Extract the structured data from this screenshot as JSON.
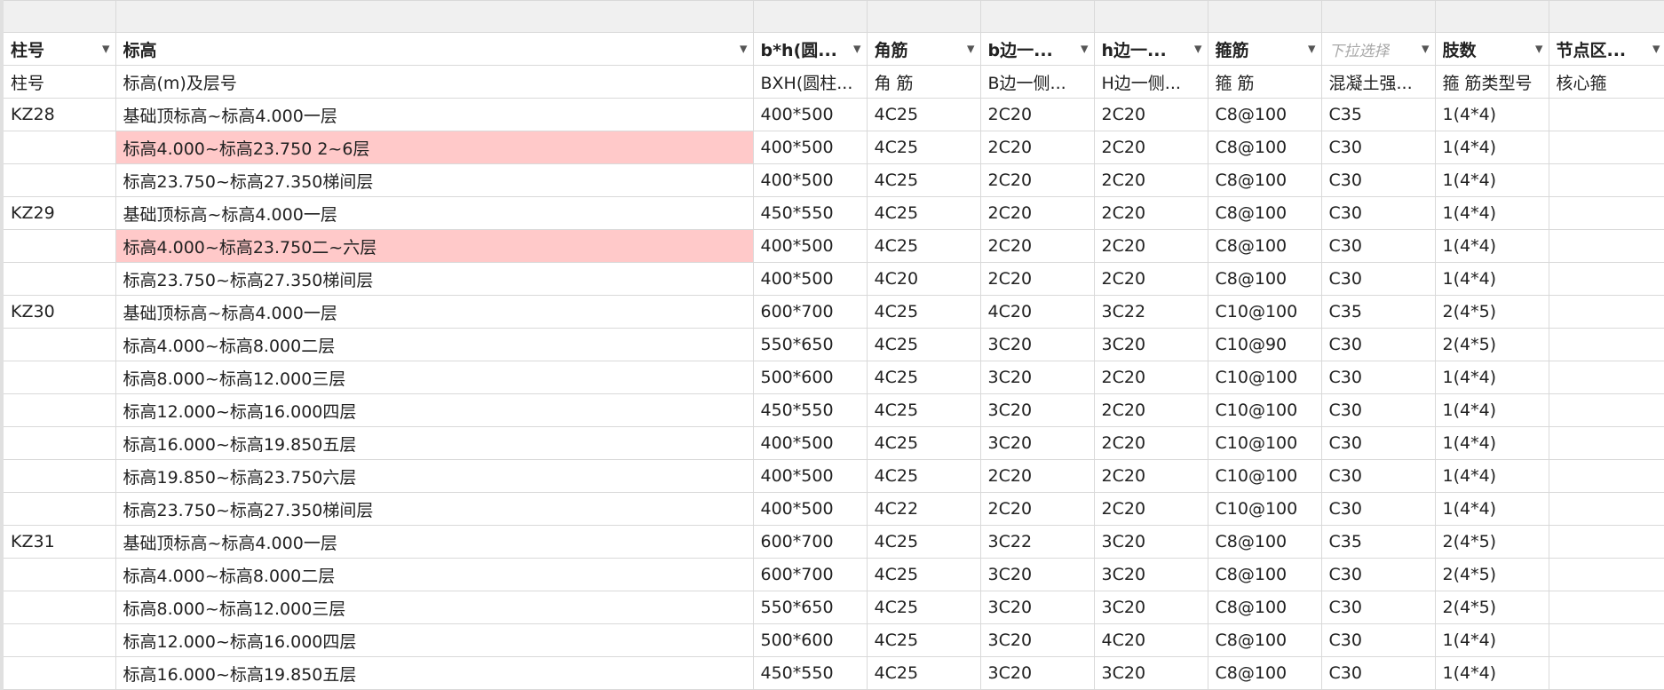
{
  "icons": {
    "dropdown": "triangle-down-icon"
  },
  "highlight_color": "#ffc9c9",
  "columns": [
    {
      "header": "柱号",
      "sub": "柱号"
    },
    {
      "header": "标高",
      "sub": "标高(m)及层号"
    },
    {
      "header": "b*h(圆...",
      "sub": "BXH(圆柱..."
    },
    {
      "header": "角筋",
      "sub": "角 筋"
    },
    {
      "header": "b边一...",
      "sub": "B边一侧..."
    },
    {
      "header": "h边一...",
      "sub": "H边一侧..."
    },
    {
      "header": "箍筋",
      "sub": "箍 筋"
    },
    {
      "header": "下拉选择",
      "sub": "混凝土强...",
      "placeholder": true
    },
    {
      "header": "肢数",
      "sub": "箍 筋类型号"
    },
    {
      "header": "节点区...",
      "sub": "核心箍"
    }
  ],
  "rows": [
    {
      "cells": [
        "KZ28",
        "基础顶标高~标高4.000一层",
        "400*500",
        "4C25",
        "2C20",
        "2C20",
        "C8@100",
        "C35",
        "1(4*4)",
        ""
      ],
      "highlight": false
    },
    {
      "cells": [
        "",
        "标高4.000~标高23.750 2~6层",
        "400*500",
        "4C25",
        "2C20",
        "2C20",
        "C8@100",
        "C30",
        "1(4*4)",
        ""
      ],
      "highlight": true
    },
    {
      "cells": [
        "",
        "标高23.750~标高27.350梯间层",
        "400*500",
        "4C25",
        "2C20",
        "2C20",
        "C8@100",
        "C30",
        "1(4*4)",
        ""
      ],
      "highlight": false
    },
    {
      "cells": [
        "KZ29",
        "基础顶标高~标高4.000一层",
        "450*550",
        "4C25",
        "2C20",
        "2C20",
        "C8@100",
        "C30",
        "1(4*4)",
        ""
      ],
      "highlight": false
    },
    {
      "cells": [
        "",
        "标高4.000~标高23.750二~六层",
        "400*500",
        "4C25",
        "2C20",
        "2C20",
        "C8@100",
        "C30",
        "1(4*4)",
        ""
      ],
      "highlight": true
    },
    {
      "cells": [
        "",
        "标高23.750~标高27.350梯间层",
        "400*500",
        "4C20",
        "2C20",
        "2C20",
        "C8@100",
        "C30",
        "1(4*4)",
        ""
      ],
      "highlight": false
    },
    {
      "cells": [
        "KZ30",
        "基础顶标高~标高4.000一层",
        "600*700",
        "4C25",
        "4C20",
        "3C22",
        "C10@100",
        "C35",
        "2(4*5)",
        ""
      ],
      "highlight": false
    },
    {
      "cells": [
        "",
        "标高4.000~标高8.000二层",
        "550*650",
        "4C25",
        "3C20",
        "3C20",
        "C10@90",
        "C30",
        "2(4*5)",
        ""
      ],
      "highlight": false
    },
    {
      "cells": [
        "",
        "标高8.000~标高12.000三层",
        "500*600",
        "4C25",
        "3C20",
        "2C20",
        "C10@100",
        "C30",
        "1(4*4)",
        ""
      ],
      "highlight": false
    },
    {
      "cells": [
        "",
        "标高12.000~标高16.000四层",
        "450*550",
        "4C25",
        "3C20",
        "2C20",
        "C10@100",
        "C30",
        "1(4*4)",
        ""
      ],
      "highlight": false
    },
    {
      "cells": [
        "",
        "标高16.000~标高19.850五层",
        "400*500",
        "4C25",
        "3C20",
        "2C20",
        "C10@100",
        "C30",
        "1(4*4)",
        ""
      ],
      "highlight": false
    },
    {
      "cells": [
        "",
        "标高19.850~标高23.750六层",
        "400*500",
        "4C25",
        "2C20",
        "2C20",
        "C10@100",
        "C30",
        "1(4*4)",
        ""
      ],
      "highlight": false
    },
    {
      "cells": [
        "",
        "标高23.750~标高27.350梯间层",
        "400*500",
        "4C22",
        "2C20",
        "2C20",
        "C10@100",
        "C30",
        "1(4*4)",
        ""
      ],
      "highlight": false
    },
    {
      "cells": [
        "KZ31",
        "基础顶标高~标高4.000一层",
        "600*700",
        "4C25",
        "3C22",
        "3C20",
        "C8@100",
        "C35",
        "2(4*5)",
        ""
      ],
      "highlight": false
    },
    {
      "cells": [
        "",
        "标高4.000~标高8.000二层",
        "600*700",
        "4C25",
        "3C20",
        "3C20",
        "C8@100",
        "C30",
        "2(4*5)",
        ""
      ],
      "highlight": false
    },
    {
      "cells": [
        "",
        "标高8.000~标高12.000三层",
        "550*650",
        "4C25",
        "3C20",
        "3C20",
        "C8@100",
        "C30",
        "2(4*5)",
        ""
      ],
      "highlight": false
    },
    {
      "cells": [
        "",
        "标高12.000~标高16.000四层",
        "500*600",
        "4C25",
        "3C20",
        "4C20",
        "C8@100",
        "C30",
        "1(4*4)",
        ""
      ],
      "highlight": false
    },
    {
      "cells": [
        "",
        "标高16.000~标高19.850五层",
        "450*550",
        "4C25",
        "3C20",
        "3C20",
        "C8@100",
        "C30",
        "1(4*4)",
        ""
      ],
      "highlight": false
    }
  ]
}
